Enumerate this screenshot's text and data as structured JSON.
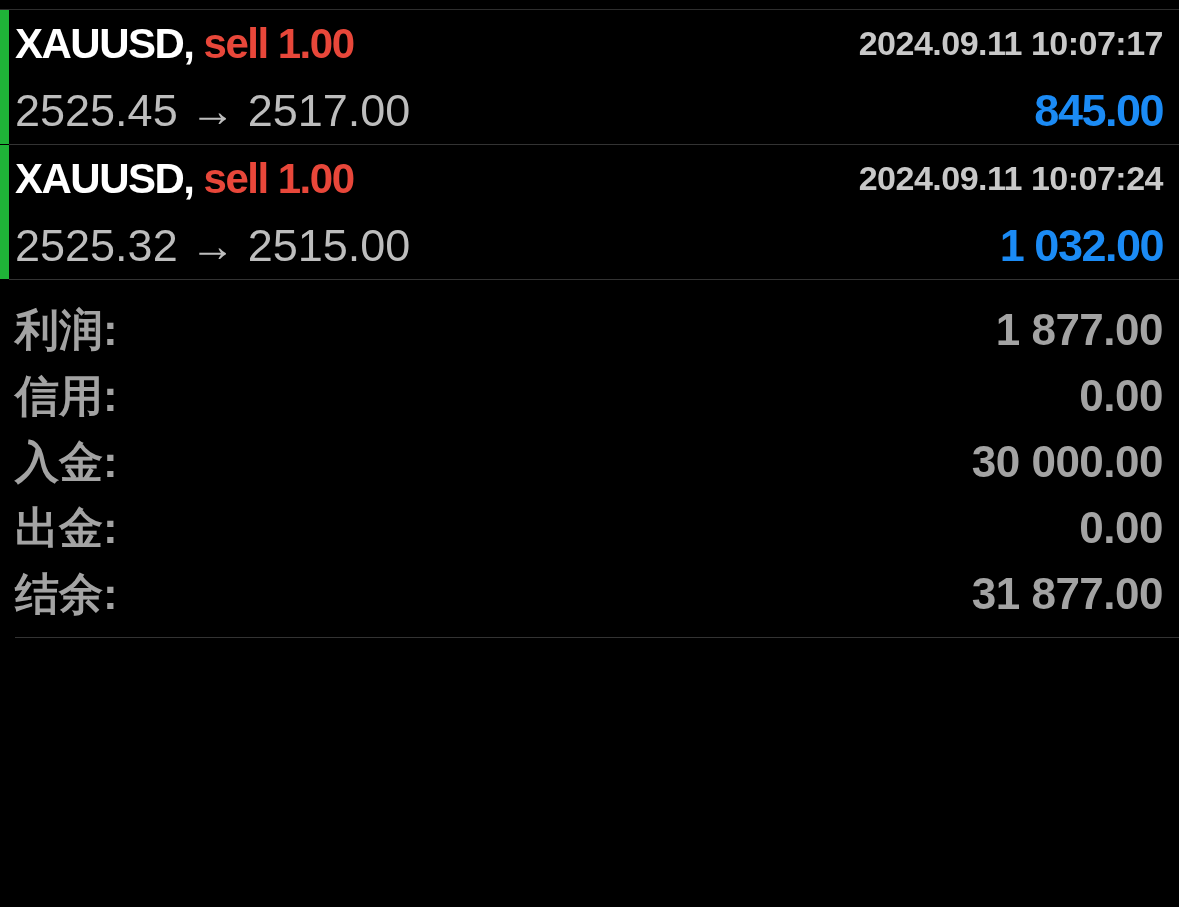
{
  "trades": [
    {
      "symbol": "XAUUSD,",
      "side": "sell 1.00",
      "time": "2024.09.11 10:07:17",
      "prices": "2525.45 → 2517.00",
      "profit": "845.00",
      "color": "#1fb338"
    },
    {
      "symbol": "XAUUSD,",
      "side": "sell 1.00",
      "time": "2024.09.11 10:07:24",
      "prices": "2525.32 → 2515.00",
      "profit": "1 032.00",
      "color": "#1fb338"
    }
  ],
  "summary": [
    {
      "label": "利润:",
      "value": "1 877.00"
    },
    {
      "label": "信用:",
      "value": "0.00"
    },
    {
      "label": "入金:",
      "value": "30 000.00"
    },
    {
      "label": "出金:",
      "value": "0.00"
    },
    {
      "label": "结余:",
      "value": "31 877.00"
    }
  ]
}
